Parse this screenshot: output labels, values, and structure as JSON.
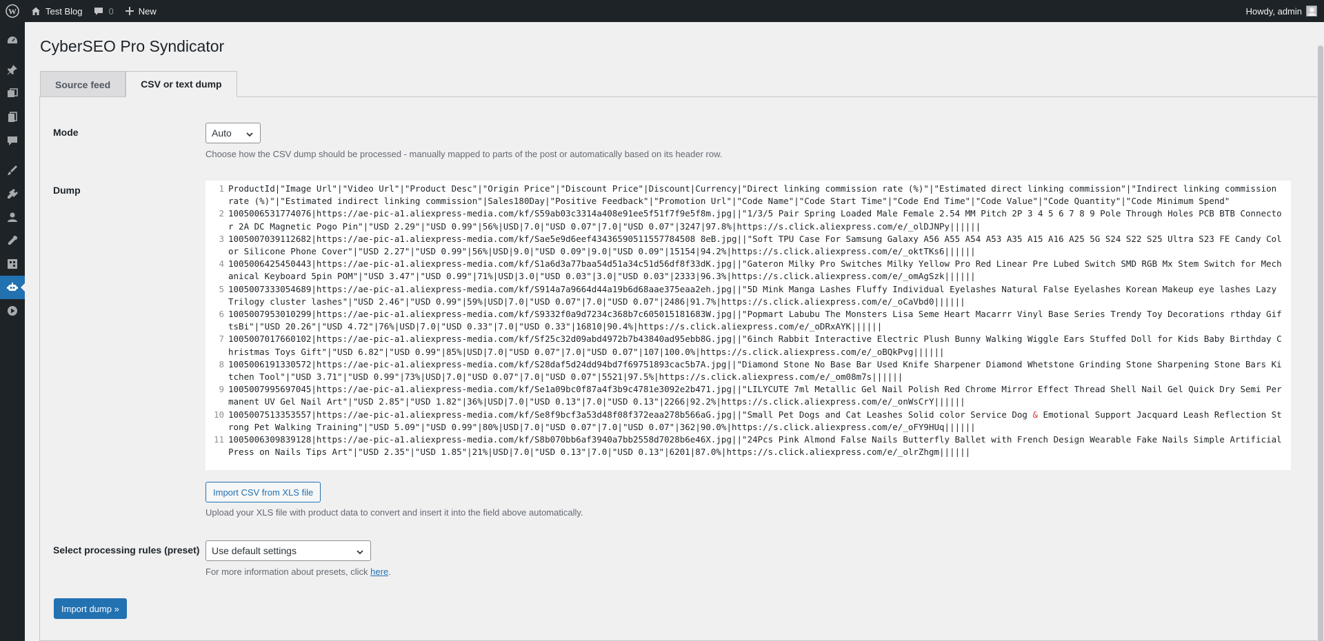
{
  "adminbar": {
    "site_name": "Test Blog",
    "comments_count": "0",
    "new_label": "New",
    "howdy": "Howdy, admin"
  },
  "sidebar": {
    "items": [
      {
        "icon": "dashboard-icon"
      },
      {
        "icon": "posts-icon"
      },
      {
        "icon": "media-icon"
      },
      {
        "icon": "pages-icon"
      },
      {
        "icon": "comments-icon"
      },
      {
        "icon": "appearance-icon"
      },
      {
        "icon": "plugins-icon"
      },
      {
        "icon": "users-icon"
      },
      {
        "icon": "tools-icon"
      },
      {
        "icon": "settings-icon"
      },
      {
        "icon": "cyberseo-icon"
      },
      {
        "icon": "play-icon"
      }
    ]
  },
  "page": {
    "title": "CyberSEO Pro Syndicator",
    "tabs": [
      {
        "label": "Source feed"
      },
      {
        "label": "CSV or text dump"
      }
    ]
  },
  "form": {
    "mode_label": "Mode",
    "mode_value": "Auto",
    "mode_desc": "Choose how the CSV dump should be processed - manually mapped to parts of the post or automatically based on its header row.",
    "dump_label": "Dump",
    "import_xls_button": "Import CSV from XLS file",
    "import_xls_desc": "Upload your XLS file with product data to convert and insert it into the field above automatically.",
    "preset_label": "Select processing rules (preset)",
    "preset_value": "Use default settings",
    "preset_desc": "For more information about presets, click ",
    "preset_link": "here",
    "preset_desc_end": ".",
    "import_dump_button": "Import dump »"
  },
  "dump_lines": [
    {
      "num": "1",
      "text": "ProductId|\"Image Url\"|\"Video Url\"|\"Product Desc\"|\"Origin Price\"|\"Discount Price\"|Discount|Currency|\"Direct linking commission rate (%)\"|\"Estimated direct linking commission\"|\"Indirect linking commission rate (%)\"|\"Estimated indirect linking commission\"|Sales180Day|\"Positive Feedback\"|\"Promotion Url\"|\"Code Name\"|\"Code Start Time\"|\"Code End Time\"|\"Code Value\"|\"Code Quantity\"|\"Code Minimum Spend\""
    },
    {
      "num": "2",
      "text": "1005006531774076|https://ae-pic-a1.aliexpress-media.com/kf/S59ab03c3314a408e91ee5f51f7f9e5f8m.jpg||\"1/3/5 Pair Spring Loaded Male Female 2.54 MM Pitch 2P 3 4 5 6 7 8 9 Pole Through Holes PCB BTB Connector 2A DC Magnetic Pogo Pin\"|\"USD 2.29\"|\"USD 0.99\"|56%|USD|7.0|\"USD 0.07\"|7.0|\"USD 0.07\"|3247|97.8%|https://s.click.aliexpress.com/e/_olDJNPy||||||"
    },
    {
      "num": "3",
      "text": "1005007039112682|https://ae-pic-a1.aliexpress-media.com/kf/Sae5e9d6eef43436590511557784508 8eB.jpg||\"Soft TPU Case For Samsung Galaxy A56 A55 A54 A53 A35 A15 A16 A25 5G S24 S22 S25 Ultra S23 FE Candy Color Silicone Phone Cover\"|\"USD 2.27\"|\"USD 0.99\"|56%|USD|9.0|\"USD 0.09\"|9.0|\"USD 0.09\"|15154|94.2%|https://s.click.aliexpress.com/e/_oktTKs6||||||"
    },
    {
      "num": "4",
      "text": "1005006425450443|https://ae-pic-a1.aliexpress-media.com/kf/S1a6d3a77baa54d51a34c51d56df8f33dK.jpg||\"Gateron Milky Pro Switches Milky Yellow Pro Red Linear Pre Lubed Switch SMD RGB Mx Stem Switch for Mechanical Keyboard 5pin POM\"|\"USD 3.47\"|\"USD 0.99\"|71%|USD|3.0|\"USD 0.03\"|3.0|\"USD 0.03\"|2333|96.3%|https://s.click.aliexpress.com/e/_omAgSzk||||||"
    },
    {
      "num": "5",
      "text": "1005007333054689|https://ae-pic-a1.aliexpress-media.com/kf/S914a7a9664d44a19b6d68aae375eaa2eh.jpg||\"5D Mink Manga Lashes Fluffy Individual Eyelashes Natural False Eyelashes Korean Makeup eye lashes Lazy Trilogy cluster lashes\"|\"USD 2.46\"|\"USD 0.99\"|59%|USD|7.0|\"USD 0.07\"|7.0|\"USD 0.07\"|2486|91.7%|https://s.click.aliexpress.com/e/_oCaVbd0||||||"
    },
    {
      "num": "6",
      "text": "1005007953010299|https://ae-pic-a1.aliexpress-media.com/kf/S9332f0a9d7234c368b7c605015181683W.jpg||\"Popmart Labubu The Monsters Lisa Seme Heart Macarrr Vinyl Base Series Trendy Toy Decorations rthday GiftsBi\"|\"USD 20.26\"|\"USD 4.72\"|76%|USD|7.0|\"USD 0.33\"|7.0|\"USD 0.33\"|16810|90.4%|https://s.click.aliexpress.com/e/_oDRxAYK||||||"
    },
    {
      "num": "7",
      "text": "1005007017660102|https://ae-pic-a1.aliexpress-media.com/kf/Sf25c32d09abd4972b7b43840ad95ebb8G.jpg||\"6inch Rabbit Interactive Electric Plush Bunny Walking Wiggle Ears Stuffed Doll for Kids Baby Birthday Christmas Toys Gift\"|\"USD 6.82\"|\"USD 0.99\"|85%|USD|7.0|\"USD 0.07\"|7.0|\"USD 0.07\"|107|100.0%|https://s.click.aliexpress.com/e/_oBQkPvg||||||"
    },
    {
      "num": "8",
      "text": "1005006191330572|https://ae-pic-a1.aliexpress-media.com/kf/S28daf5d24dd94bd7f69751893cac5b7A.jpg||\"Diamond Stone No Base Bar Used Knife Sharpener Diamond Whetstone Grinding Stone Sharpening Stone Bars Kitchen Tool\"|\"USD 3.71\"|\"USD 0.99\"|73%|USD|7.0|\"USD 0.07\"|7.0|\"USD 0.07\"|5521|97.5%|https://s.click.aliexpress.com/e/_om08m7s||||||"
    },
    {
      "num": "9",
      "text": "1005007995697045|https://ae-pic-a1.aliexpress-media.com/kf/Se1a09bc0f87a4f3b9c4781e3092e2b471.jpg||\"LILYCUTE 7ml Metallic Gel Nail Polish Red Chrome Mirror Effect Thread Shell Nail Gel Quick Dry Semi Permanent UV Gel Nail Art\"|\"USD 2.85\"|\"USD 1.82\"|36%|USD|7.0|\"USD 0.13\"|7.0|\"USD 0.13\"|2266|92.2%|https://s.click.aliexpress.com/e/_onWsCrY||||||"
    },
    {
      "num": "10",
      "pre": "1005007513353557|https://ae-pic-a1.aliexpress-media.com/kf/Se8f9bcf3a53d48f08f372eaa278b566aG.jpg||\"Small Pet Dogs and Cat Leashes Solid color Service Dog ",
      "amp": "&",
      "post": " Emotional Support Jacquard Leash Reflection Strong Pet Walking Training\"|\"USD 5.09\"|\"USD 0.99\"|80%|USD|7.0|\"USD 0.07\"|7.0|\"USD 0.07\"|362|90.0%|https://s.click.aliexpress.com/e/_oFY9HUq||||||"
    },
    {
      "num": "11",
      "text": "1005006309839128|https://ae-pic-a1.aliexpress-media.com/kf/S8b070bb6af3940a7bb2558d7028b6e46X.jpg||\"24Pcs Pink Almond False Nails Butterfly Ballet with French Design Wearable Fake Nails Simple Artificial Press on Nails Tips Art\"|\"USD 2.35\"|\"USD 1.85\"|21%|USD|7.0|\"USD 0.13\"|7.0|\"USD 0.13\"|6201|87.0%|https://s.click.aliexpress.com/e/_olrZhgm||||||"
    }
  ]
}
